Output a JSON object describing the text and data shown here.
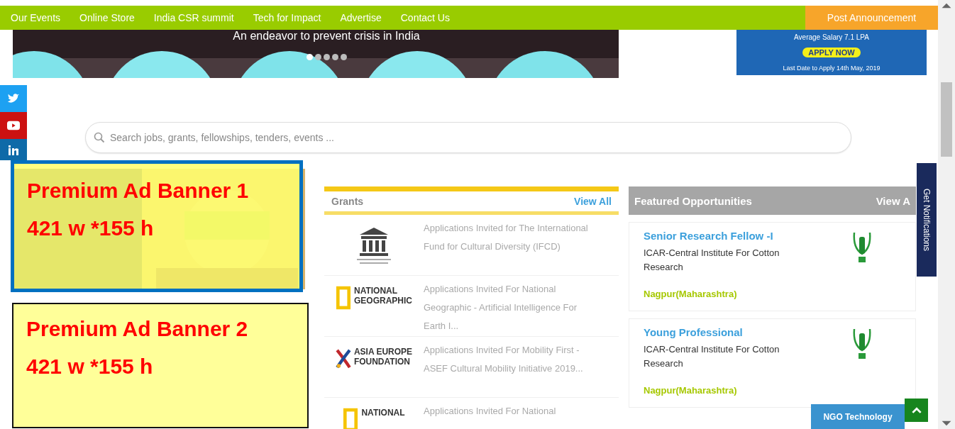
{
  "nav": {
    "links": [
      "Our Events",
      "Online Store",
      "India CSR summit",
      "Tech for Impact",
      "Advertise",
      "Contact Us"
    ],
    "post_button": "Post Announcement"
  },
  "hero": {
    "caption": "An endeavor to prevent crisis in India",
    "slides": [
      {
        "selected": true
      },
      {
        "selected": false
      },
      {
        "selected": false
      },
      {
        "selected": false
      },
      {
        "selected": false
      }
    ]
  },
  "side_ad": {
    "salary": "Average Salary 7.1 LPA",
    "button": "APPLY NOW",
    "deadline": "Last Date to Apply 14th May, 2019"
  },
  "search": {
    "placeholder": "Search jobs, grants, fellowships, tenders, events ..."
  },
  "grants": {
    "title": "Grants",
    "view_all": "View All",
    "items": [
      {
        "kind": "unesco",
        "text": "Applications Invited for The International Fund for Cultural Diversity (IFCD)"
      },
      {
        "kind": "natgeo",
        "logo_lines": [
          "NATIONAL",
          "GEOGRAPHIC"
        ],
        "text": "Applications Invited For National Geographic - Artificial Intelligence For Earth I..."
      },
      {
        "kind": "asef",
        "logo_lines": [
          "ASIA EUROPE",
          "FOUNDATION"
        ],
        "text": "Applications Invited For Mobility First - ASEF Cultural Mobility Initiative 2019..."
      },
      {
        "kind": "natgeo",
        "logo_lines": [
          "NATIONAL"
        ],
        "text": "Applications Invited For National"
      }
    ]
  },
  "featured": {
    "title": "Featured Opportunities",
    "view_all": "View A",
    "items": [
      {
        "title": "Senior Research Fellow -I",
        "org": "ICAR-Central Institute For Cotton Research",
        "location": "Nagpur(Maharashtra)"
      },
      {
        "title": "Young Professional",
        "org": "ICAR-Central Institute For Cotton Research",
        "location": "Nagpur(Maharashtra)"
      }
    ]
  },
  "notifications_tab": "Get Notifications",
  "ngo_button": "NGO Technology",
  "banners": [
    {
      "kind": "translucent",
      "title": "Premium Ad Banner 1",
      "size": "421 w *155 h"
    },
    {
      "kind": "opaque",
      "title": "Premium Ad Banner 2",
      "size": "421 w *155 h"
    }
  ]
}
